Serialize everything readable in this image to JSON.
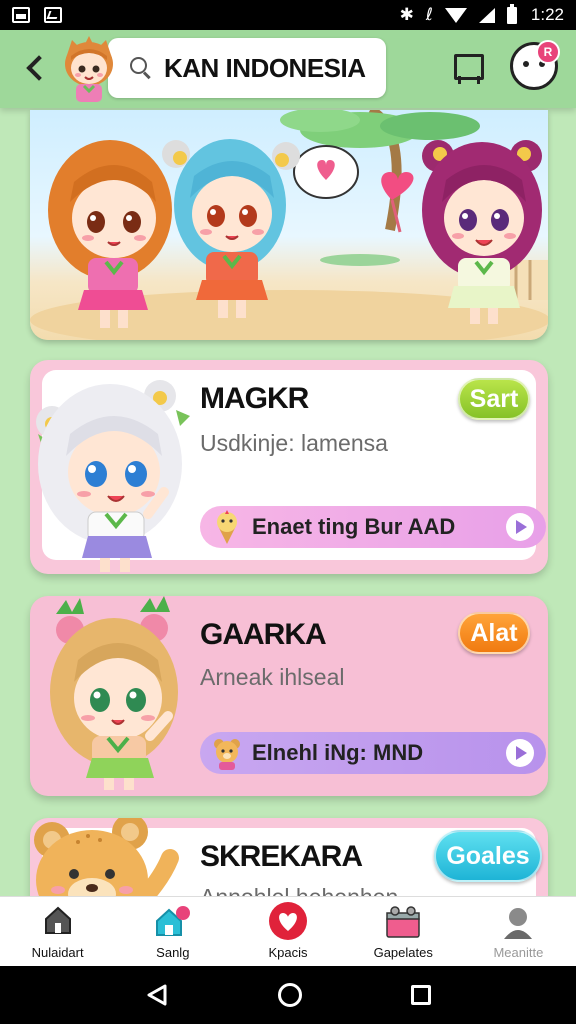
{
  "status_bar": {
    "time": "1:22"
  },
  "header": {
    "search_query": "KAN INDONESIA",
    "profile_badge": "R"
  },
  "cards": [
    {
      "title": "MAGKR",
      "subtitle": "Usdkinje: lamensa",
      "badge": "Sart",
      "badge_color": "#9ad33a",
      "pill_text": "Enaet ting Bur AAD",
      "pill_color": "#f2afe4"
    },
    {
      "title": "GAARKA",
      "subtitle": "Arneak ihlseal",
      "badge": "Alat",
      "badge_color": "#f58a1f",
      "pill_text": "Elnehl iNg: MND",
      "pill_color": "#c3a1ef"
    },
    {
      "title": "SKREKARA",
      "subtitle": "Annohlel hehenhen",
      "badge": "Goales",
      "badge_color": "#2cc3df"
    }
  ],
  "bottom_nav": [
    {
      "label": "Nulaidart",
      "icon": "home-icon"
    },
    {
      "label": "Sanlg",
      "icon": "house-notify-icon"
    },
    {
      "label": "Kpacis",
      "icon": "heart-circle-icon"
    },
    {
      "label": "Gapelates",
      "icon": "gift-box-icon"
    },
    {
      "label": "Meanitte",
      "icon": "person-icon"
    }
  ],
  "colors": {
    "header_bg": "#9ed89a",
    "page_bg": "#bfe8b8",
    "card_pink": "#f9c7da",
    "accent_pink": "#e8437a"
  }
}
